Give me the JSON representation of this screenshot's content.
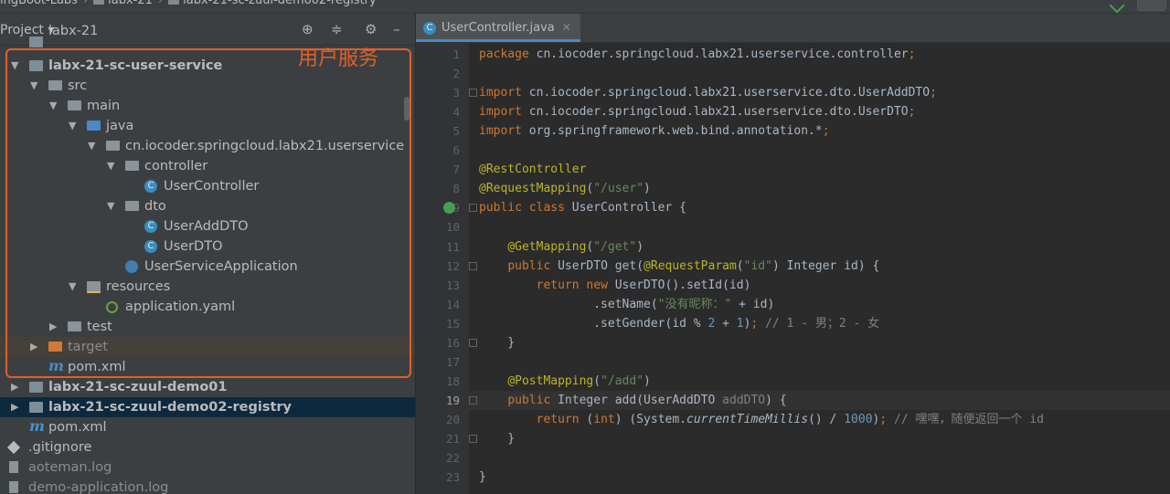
{
  "breadcrumbs": [
    "ingBoot-Labs",
    "labx-21",
    "labx-21-sc-zuul-demo02-registry"
  ],
  "left_panel": {
    "title": "Project",
    "toolbar_icons": [
      "locate-icon",
      "collapse-icon",
      "gear-icon",
      "minimize-icon"
    ],
    "tree": [
      {
        "label": "labx-21",
        "indent": 0,
        "icon": "module",
        "bold": false,
        "arrow": "",
        "clip": true
      },
      {
        "label": "labx-21-sc-user-service",
        "indent": 0,
        "icon": "module",
        "bold": true,
        "arrow": "down"
      },
      {
        "label": "src",
        "indent": 1,
        "icon": "folder",
        "arrow": "down"
      },
      {
        "label": "main",
        "indent": 2,
        "icon": "folder",
        "arrow": "down"
      },
      {
        "label": "java",
        "indent": 3,
        "icon": "src",
        "arrow": "down"
      },
      {
        "label": "cn.iocoder.springcloud.labx21.userservice",
        "indent": 4,
        "icon": "folder",
        "arrow": "down"
      },
      {
        "label": "controller",
        "indent": 5,
        "icon": "folder",
        "arrow": "down"
      },
      {
        "label": "UserController",
        "indent": 6,
        "icon": "class",
        "arrow": ""
      },
      {
        "label": "dto",
        "indent": 5,
        "icon": "folder",
        "arrow": "down"
      },
      {
        "label": "UserAddDTO",
        "indent": 6,
        "icon": "class",
        "arrow": ""
      },
      {
        "label": "UserDTO",
        "indent": 6,
        "icon": "class",
        "arrow": ""
      },
      {
        "label": "UserServiceApplication",
        "indent": 5,
        "icon": "spring",
        "arrow": ""
      },
      {
        "label": "resources",
        "indent": 3,
        "icon": "res",
        "arrow": "down"
      },
      {
        "label": "application.yaml",
        "indent": 4,
        "icon": "yaml",
        "arrow": ""
      },
      {
        "label": "test",
        "indent": 2,
        "icon": "folder",
        "arrow": "right"
      },
      {
        "label": "target",
        "indent": 1,
        "icon": "target",
        "arrow": "right",
        "excluded": true
      },
      {
        "label": "pom.xml",
        "indent": 1,
        "icon": "m",
        "arrow": ""
      },
      {
        "label": "labx-21-sc-zuul-demo01",
        "indent": 0,
        "icon": "module",
        "bold": true,
        "arrow": "right"
      },
      {
        "label": "labx-21-sc-zuul-demo02-registry",
        "indent": 0,
        "icon": "module",
        "bold": true,
        "arrow": "right",
        "selected": true
      },
      {
        "label": "pom.xml",
        "indent": 0,
        "icon": "m",
        "arrow": "",
        "root": true
      },
      {
        "label": ".gitignore",
        "indent": -1,
        "icon": "git",
        "arrow": ""
      },
      {
        "label": "aoteman.log",
        "indent": -1,
        "icon": "log",
        "arrow": "",
        "muted": true
      },
      {
        "label": "demo-application.log",
        "indent": -1,
        "icon": "log",
        "arrow": "",
        "muted": true
      }
    ],
    "annotation": "用户服务"
  },
  "editor": {
    "tab_label": "UserController.java",
    "current_line": 19,
    "lines": [
      [
        [
          "k",
          "package "
        ],
        [
          "t",
          "cn.iocoder.springcloud.labx21.userservice.controller"
        ],
        [
          "k",
          ";"
        ]
      ],
      [],
      [
        [
          "k",
          "import "
        ],
        [
          "t",
          "cn.iocoder.springcloud.labx21.userservice.dto.UserAddDTO"
        ],
        [
          "k",
          ";"
        ]
      ],
      [
        [
          "k",
          "import "
        ],
        [
          "t",
          "cn.iocoder.springcloud.labx21.userservice.dto.UserDTO"
        ],
        [
          "k",
          ";"
        ]
      ],
      [
        [
          "k",
          "import "
        ],
        [
          "t",
          "org.springframework.web.bind.annotation.*"
        ],
        [
          "k",
          ";"
        ]
      ],
      [],
      [
        [
          "a",
          "@RestController"
        ]
      ],
      [
        [
          "a",
          "@RequestMapping"
        ],
        [
          "t",
          "("
        ],
        [
          "s",
          "\"/user\""
        ],
        [
          "t",
          ")"
        ]
      ],
      [
        [
          "k",
          "public class "
        ],
        [
          "t",
          "UserController {"
        ]
      ],
      [],
      [
        [
          "t",
          "    "
        ],
        [
          "a",
          "@GetMapping"
        ],
        [
          "t",
          "("
        ],
        [
          "s",
          "\"/get\""
        ],
        [
          "t",
          ")"
        ]
      ],
      [
        [
          "t",
          "    "
        ],
        [
          "k",
          "public "
        ],
        [
          "t",
          "UserDTO "
        ],
        [
          "f",
          "get"
        ],
        [
          "t",
          "("
        ],
        [
          "a",
          "@RequestParam"
        ],
        [
          "t",
          "("
        ],
        [
          "s",
          "\"id\""
        ],
        [
          "t",
          ") Integer id) {"
        ]
      ],
      [
        [
          "t",
          "        "
        ],
        [
          "k",
          "return new "
        ],
        [
          "t",
          "UserDTO().setId(id)"
        ]
      ],
      [
        [
          "t",
          "                .setName("
        ],
        [
          "s",
          "\"没有昵称：\""
        ],
        [
          "t",
          " + id)"
        ]
      ],
      [
        [
          "t",
          "                .setGender(id % "
        ],
        [
          "n",
          "2"
        ],
        [
          "t",
          " + "
        ],
        [
          "n",
          "1"
        ],
        [
          "t",
          ")"
        ],
        [
          "k",
          ";"
        ],
        [
          "c",
          " // 1 - 男；2 - 女"
        ]
      ],
      [
        [
          "t",
          "    }"
        ]
      ],
      [],
      [
        [
          "t",
          "    "
        ],
        [
          "a",
          "@PostMapping"
        ],
        [
          "t",
          "("
        ],
        [
          "s",
          "\"/add\""
        ],
        [
          "t",
          ")"
        ]
      ],
      [
        [
          "t",
          "    "
        ],
        [
          "k",
          "public "
        ],
        [
          "t",
          "Integer "
        ],
        [
          "f",
          "add"
        ],
        [
          "t",
          "(UserAddDTO "
        ],
        [
          "u",
          "addDTO"
        ],
        [
          "t",
          ") {"
        ]
      ],
      [
        [
          "t",
          "        "
        ],
        [
          "k",
          "return "
        ],
        [
          "t",
          "("
        ],
        [
          "k",
          "int"
        ],
        [
          "t",
          ") (System."
        ],
        [
          "i",
          "currentTimeMillis"
        ],
        [
          "t",
          "() / "
        ],
        [
          "n",
          "1000"
        ],
        [
          "t",
          ")"
        ],
        [
          "k",
          ";"
        ],
        [
          "c",
          " // 嘿嘿，随便返回一个 id"
        ]
      ],
      [
        [
          "t",
          "    }"
        ]
      ],
      [],
      [
        [
          "t",
          "}"
        ]
      ]
    ]
  },
  "colors": {
    "accent_annotation": "#e05f2a",
    "selection": "#0d293e",
    "keyword": "#cc7832",
    "annotation": "#bbb529",
    "string": "#6a8759",
    "number": "#6897bb"
  }
}
